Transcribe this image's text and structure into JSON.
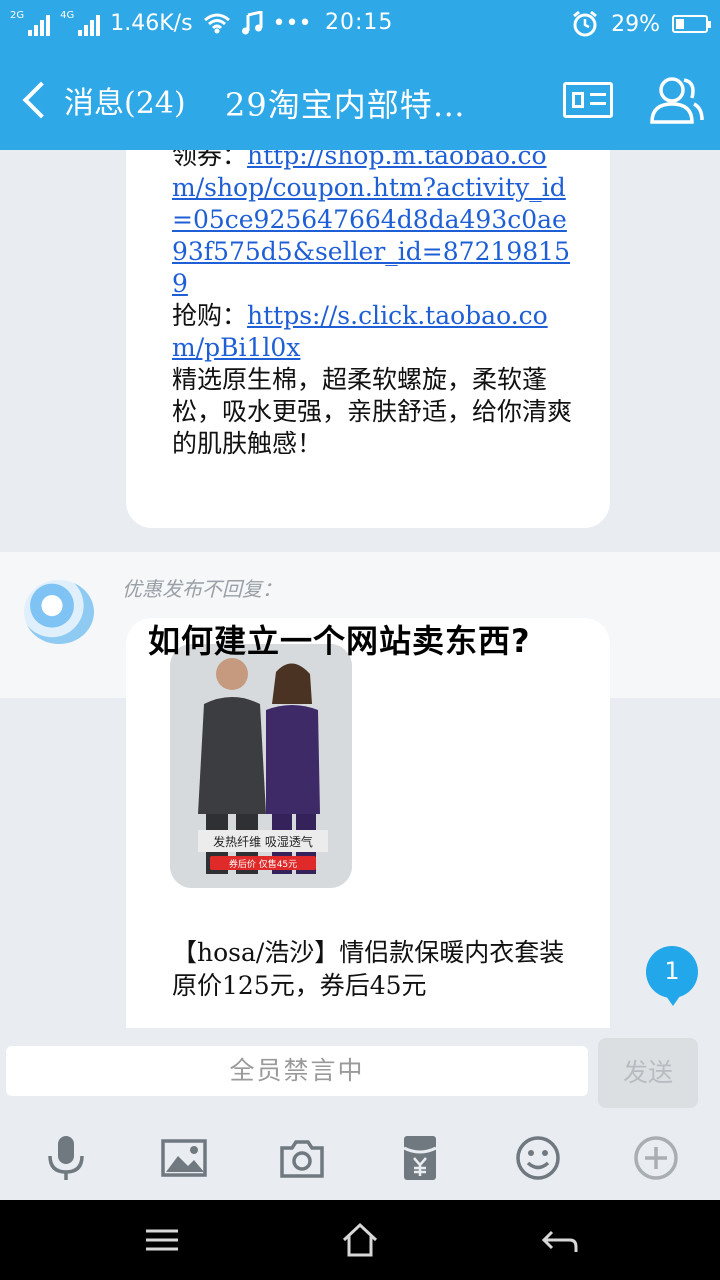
{
  "status_bar": {
    "sim1": "2G",
    "sim2": "4G",
    "speed": "1.46K/s",
    "extra": "•••",
    "time": "20:15",
    "battery": "29%",
    "battery_level": 0.29,
    "icons": [
      "signal-icon",
      "wifi-icon",
      "music-icon",
      "alarm-icon",
      "battery-icon"
    ]
  },
  "header": {
    "back_label": "消息(24)",
    "title": "29淘宝内部特…",
    "icons": [
      "profile-card-icon",
      "group-members-icon"
    ]
  },
  "messages": [
    {
      "line_prefix": "领券：",
      "link1": "http://shop.m.taobao.com/shop/coupon.htm?activity_id=05ce925647664d8da493c0ae93f575d5&seller_id=872198159",
      "buy_prefix": "抢购：",
      "link2": "https://s.click.taobao.com/pBi1l0x",
      "body": "精选原生棉，超柔软螺旋，柔软蓬松，吸水更强，亲肤舒适，给你清爽的肌肤触感！"
    },
    {
      "sender": "优惠发布不回复：",
      "image_caption": "发热纤维 吸湿透气",
      "image_tag": "券后价 仅售45元",
      "product_title": "【hosa/浩沙】情侣款保暖内衣套装",
      "price_line": "原价125元，券后45元"
    }
  ],
  "overlay_title": "如何建立一个网站卖东西?",
  "unread_count": "1",
  "input": {
    "muted_text": "全员禁言中",
    "send_label": "发送"
  },
  "toolbar_icons": [
    "microphone-icon",
    "image-icon",
    "camera-icon",
    "red-packet-icon",
    "emoji-icon",
    "plus-icon"
  ],
  "navbar_icons": [
    "menu-icon",
    "home-icon",
    "back-icon"
  ],
  "colors": {
    "accent": "#2fa8e8",
    "link": "#1f5fd6",
    "badge": "#22a7ea",
    "background": "#e9edf1"
  }
}
